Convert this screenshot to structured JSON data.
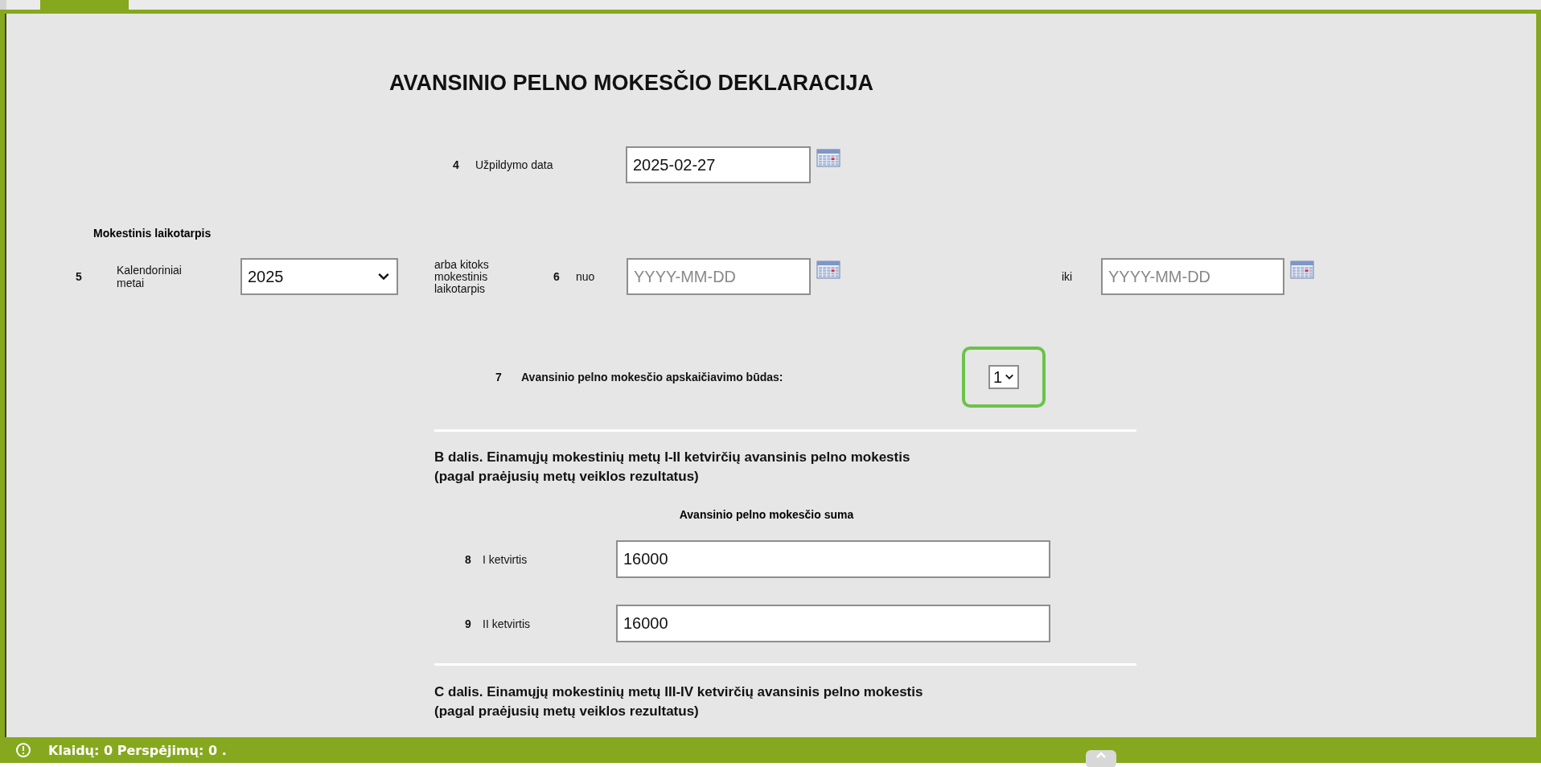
{
  "title": "AVANSINIO PELNO MOKESČIO DEKLARACIJA",
  "fill_date": {
    "number": "4",
    "label": "Užpildymo data",
    "value": "2025-02-27"
  },
  "tax_period": {
    "heading": "Mokestinis laikotarpis",
    "year": {
      "number": "5",
      "label": "Kalendoriniai metai",
      "value": "2025"
    },
    "other_label": "arba kitoks mokestinis laikotarpis",
    "from": {
      "number": "6",
      "label": "nuo",
      "placeholder": "YYYY-MM-DD"
    },
    "to": {
      "label": "iki",
      "placeholder": "YYYY-MM-DD"
    }
  },
  "method": {
    "number": "7",
    "label": "Avansinio pelno mokesčio apskaičiavimo būdas:",
    "value": "1",
    "focused": true
  },
  "sections": [
    {
      "heading": "B dalis. Einamųjų mokestinių metų I-II ketvirčių avansinis pelno mokestis\n(pagal praėjusių metų veiklos rezultatus)",
      "subheading": "Avansinio pelno mokesčio suma",
      "rows": [
        {
          "number": "8",
          "label": "I ketvirtis",
          "value": "16000"
        },
        {
          "number": "9",
          "label": "II ketvirtis",
          "value": "16000"
        }
      ]
    },
    {
      "heading": "C dalis. Einamųjų mokestinių metų III-IV ketvirčių avansinis pelno mokestis\n(pagal praėjusių metų veiklos rezultatus)"
    }
  ],
  "status_bar": "Klaidų: 0 Perspėjimų: 0 ."
}
